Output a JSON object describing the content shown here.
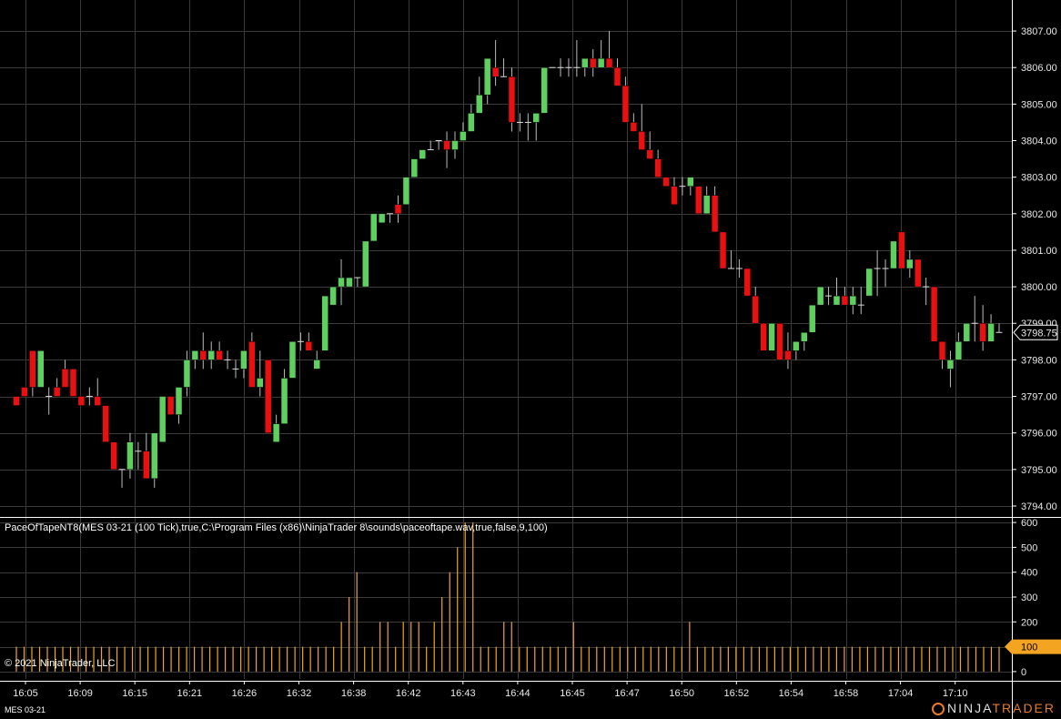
{
  "colors": {
    "up": "#5fcf5f",
    "down": "#e81010",
    "volume": "#f3a521",
    "grid": "#3a3a3a",
    "price_marker_bg": "#000000",
    "volume_marker_bg": "#f3a521"
  },
  "indicator_label": "PaceOfTapeNT8(MES 03-21 (100 Tick),true,C:\\Program Files (x86)\\NinjaTrader 8\\sounds\\paceoftape.wav,true,false,9,100)",
  "copyright": "© 2021 NinjaTrader, LLC",
  "instrument": "MES 03-21",
  "brand": {
    "ninja": "NINJA",
    "trader": "TRADER"
  },
  "price_marker": "3798.75",
  "volume_marker": "100",
  "chart_data": [
    {
      "type": "candlestick",
      "title": "MES 03-21 (100 Tick)",
      "ylim": [
        3793.75,
        3807.5
      ],
      "y_ticks": [
        "3794.00",
        "3795.00",
        "3796.00",
        "3797.00",
        "3798.00",
        "3799.00",
        "3800.00",
        "3801.00",
        "3802.00",
        "3803.00",
        "3804.00",
        "3805.00",
        "3806.00",
        "3807.00"
      ],
      "x_ticks": [
        "16:05",
        "16:09",
        "16:15",
        "16:21",
        "16:26",
        "16:32",
        "16:38",
        "16:42",
        "16:43",
        "16:44",
        "16:45",
        "16:47",
        "16:50",
        "16:52",
        "16:54",
        "16:58",
        "17:04",
        "17:10"
      ],
      "ohlc": [
        [
          3797.0,
          3797.0,
          3796.75,
          3796.75
        ],
        [
          3797.25,
          3797.25,
          3797.0,
          3797.0
        ],
        [
          3798.25,
          3798.25,
          3797.0,
          3797.25
        ],
        [
          3797.25,
          3798.25,
          3797.25,
          3798.25
        ],
        [
          3797.0,
          3797.25,
          3796.5,
          3797.0
        ],
        [
          3797.25,
          3797.5,
          3797.0,
          3797.0
        ],
        [
          3797.75,
          3798.0,
          3797.25,
          3797.25
        ],
        [
          3797.75,
          3797.75,
          3797.0,
          3797.0
        ],
        [
          3797.0,
          3797.0,
          3796.75,
          3796.75
        ],
        [
          3797.0,
          3797.25,
          3796.75,
          3797.0
        ],
        [
          3797.0,
          3797.5,
          3796.75,
          3796.75
        ],
        [
          3796.75,
          3796.75,
          3795.75,
          3795.75
        ],
        [
          3795.75,
          3795.75,
          3795.0,
          3795.0
        ],
        [
          3795.0,
          3795.0,
          3794.5,
          3795.0
        ],
        [
          3795.0,
          3796.0,
          3794.75,
          3795.75
        ],
        [
          3795.5,
          3795.75,
          3795.0,
          3795.5
        ],
        [
          3795.5,
          3796.0,
          3794.75,
          3794.75
        ],
        [
          3794.75,
          3796.0,
          3794.5,
          3796.0
        ],
        [
          3795.75,
          3797.0,
          3795.75,
          3797.0
        ],
        [
          3797.0,
          3797.0,
          3796.5,
          3796.5
        ],
        [
          3796.5,
          3797.25,
          3796.25,
          3797.25
        ],
        [
          3797.25,
          3798.25,
          3797.0,
          3798.0
        ],
        [
          3798.0,
          3798.25,
          3797.75,
          3798.25
        ],
        [
          3798.25,
          3798.75,
          3797.75,
          3798.0
        ],
        [
          3798.0,
          3798.5,
          3797.75,
          3798.25
        ],
        [
          3798.25,
          3798.5,
          3798.0,
          3798.0
        ],
        [
          3798.0,
          3798.25,
          3797.75,
          3798.0
        ],
        [
          3797.75,
          3798.0,
          3797.5,
          3797.75
        ],
        [
          3797.75,
          3798.25,
          3797.5,
          3798.25
        ],
        [
          3798.5,
          3798.75,
          3797.25,
          3797.25
        ],
        [
          3797.25,
          3798.25,
          3797.0,
          3797.5
        ],
        [
          3798.0,
          3798.0,
          3796.0,
          3796.0
        ],
        [
          3795.75,
          3796.5,
          3795.75,
          3796.25
        ],
        [
          3796.25,
          3797.75,
          3796.25,
          3797.5
        ],
        [
          3797.5,
          3798.5,
          3797.5,
          3798.5
        ],
        [
          3798.5,
          3798.75,
          3798.25,
          3798.5
        ],
        [
          3798.5,
          3798.75,
          3798.25,
          3798.25
        ],
        [
          3797.75,
          3798.25,
          3797.75,
          3798.0
        ],
        [
          3798.25,
          3799.75,
          3798.25,
          3799.75
        ],
        [
          3799.5,
          3800.0,
          3799.5,
          3800.0
        ],
        [
          3800.0,
          3800.75,
          3799.5,
          3800.25
        ],
        [
          3800.0,
          3800.25,
          3800.0,
          3800.25
        ],
        [
          3800.25,
          3800.25,
          3800.0,
          3800.25
        ],
        [
          3800.0,
          3801.25,
          3800.0,
          3801.25
        ],
        [
          3801.25,
          3802.0,
          3801.25,
          3802.0
        ],
        [
          3801.75,
          3802.0,
          3801.75,
          3802.0
        ],
        [
          3802.0,
          3802.0,
          3801.75,
          3802.0
        ],
        [
          3802.25,
          3802.5,
          3801.75,
          3802.0
        ],
        [
          3802.25,
          3803.0,
          3802.25,
          3803.0
        ],
        [
          3803.0,
          3803.5,
          3803.0,
          3803.5
        ],
        [
          3803.5,
          3803.75,
          3803.5,
          3803.75
        ],
        [
          3803.75,
          3804.0,
          3803.75,
          3803.75
        ],
        [
          3804.0,
          3804.0,
          3803.75,
          3804.0
        ],
        [
          3804.0,
          3804.25,
          3803.25,
          3803.75
        ],
        [
          3803.75,
          3804.25,
          3803.5,
          3804.0
        ],
        [
          3804.0,
          3804.5,
          3804.0,
          3804.25
        ],
        [
          3804.25,
          3805.0,
          3804.25,
          3804.75
        ],
        [
          3804.75,
          3805.75,
          3804.75,
          3805.25
        ],
        [
          3805.25,
          3806.25,
          3805.0,
          3806.25
        ],
        [
          3806.0,
          3806.75,
          3805.5,
          3805.75
        ],
        [
          3805.75,
          3806.25,
          3805.75,
          3805.75
        ],
        [
          3805.75,
          3806.0,
          3804.25,
          3804.5
        ],
        [
          3804.5,
          3804.75,
          3804.25,
          3804.5
        ],
        [
          3804.5,
          3804.75,
          3804.0,
          3804.5
        ],
        [
          3804.5,
          3804.75,
          3804.0,
          3804.75
        ],
        [
          3804.75,
          3806.0,
          3804.75,
          3806.0
        ],
        [
          3806.0,
          3806.0,
          3806.0,
          3806.0
        ],
        [
          3806.0,
          3806.25,
          3805.75,
          3806.0
        ],
        [
          3806.0,
          3806.25,
          3805.75,
          3806.0
        ],
        [
          3806.0,
          3806.75,
          3805.75,
          3806.0
        ],
        [
          3806.0,
          3806.25,
          3805.75,
          3806.25
        ],
        [
          3806.25,
          3806.5,
          3805.75,
          3806.0
        ],
        [
          3806.0,
          3806.75,
          3806.0,
          3806.25
        ],
        [
          3806.25,
          3807.0,
          3806.0,
          3806.0
        ],
        [
          3806.0,
          3806.25,
          3805.5,
          3805.5
        ],
        [
          3805.5,
          3805.75,
          3804.5,
          3804.5
        ],
        [
          3804.5,
          3804.75,
          3804.25,
          3804.25
        ],
        [
          3804.25,
          3805.0,
          3803.75,
          3803.75
        ],
        [
          3803.75,
          3804.25,
          3803.5,
          3803.5
        ],
        [
          3803.5,
          3803.75,
          3803.0,
          3803.0
        ],
        [
          3803.0,
          3803.0,
          3802.75,
          3802.75
        ],
        [
          3802.75,
          3803.0,
          3802.25,
          3802.25
        ],
        [
          3802.75,
          3803.0,
          3802.5,
          3802.75
        ],
        [
          3802.75,
          3803.0,
          3802.5,
          3803.0
        ],
        [
          3802.75,
          3802.75,
          3802.0,
          3802.0
        ],
        [
          3802.0,
          3802.75,
          3802.0,
          3802.5
        ],
        [
          3802.5,
          3802.75,
          3801.5,
          3801.5
        ],
        [
          3801.5,
          3801.5,
          3800.5,
          3800.5
        ],
        [
          3800.5,
          3801.0,
          3800.5,
          3800.5
        ],
        [
          3800.5,
          3800.75,
          3800.25,
          3800.5
        ],
        [
          3800.5,
          3800.5,
          3799.75,
          3799.75
        ],
        [
          3799.75,
          3800.0,
          3799.0,
          3799.0
        ],
        [
          3799.0,
          3799.0,
          3798.25,
          3798.25
        ],
        [
          3798.25,
          3799.0,
          3798.25,
          3799.0
        ],
        [
          3799.0,
          3799.0,
          3798.0,
          3798.0
        ],
        [
          3798.25,
          3798.75,
          3797.75,
          3798.0
        ],
        [
          3798.25,
          3798.5,
          3798.0,
          3798.5
        ],
        [
          3798.5,
          3798.75,
          3798.25,
          3798.75
        ],
        [
          3798.75,
          3799.5,
          3798.75,
          3799.5
        ],
        [
          3799.5,
          3800.0,
          3799.5,
          3800.0
        ],
        [
          3799.75,
          3800.0,
          3799.5,
          3799.75
        ],
        [
          3799.5,
          3800.25,
          3799.5,
          3799.75
        ],
        [
          3799.75,
          3800.0,
          3799.5,
          3799.5
        ],
        [
          3799.5,
          3800.0,
          3799.25,
          3799.75
        ],
        [
          3799.5,
          3800.0,
          3799.25,
          3799.5
        ],
        [
          3799.75,
          3800.5,
          3799.75,
          3800.5
        ],
        [
          3800.5,
          3801.0,
          3799.75,
          3800.5
        ],
        [
          3800.5,
          3800.75,
          3800.0,
          3800.5
        ],
        [
          3800.5,
          3801.25,
          3800.5,
          3801.25
        ],
        [
          3801.5,
          3801.5,
          3800.5,
          3800.5
        ],
        [
          3800.5,
          3801.0,
          3800.25,
          3800.75
        ],
        [
          3800.75,
          3800.75,
          3800.0,
          3800.0
        ],
        [
          3800.0,
          3800.25,
          3799.5,
          3800.0
        ],
        [
          3800.0,
          3800.0,
          3798.5,
          3798.5
        ],
        [
          3798.5,
          3798.5,
          3797.75,
          3798.0
        ],
        [
          3797.75,
          3798.25,
          3797.25,
          3798.0
        ],
        [
          3798.0,
          3798.75,
          3798.0,
          3798.5
        ],
        [
          3798.5,
          3799.0,
          3798.5,
          3799.0
        ],
        [
          3799.0,
          3799.75,
          3798.5,
          3799.0
        ],
        [
          3799.0,
          3799.5,
          3798.25,
          3798.5
        ],
        [
          3798.5,
          3799.25,
          3798.5,
          3799.0
        ],
        [
          3798.75,
          3799.0,
          3798.75,
          3798.75
        ]
      ]
    },
    {
      "type": "bar",
      "title": "PaceOfTapeNT8",
      "ylim": [
        -15,
        615
      ],
      "y_ticks": [
        "0",
        "100",
        "200",
        "300",
        "400",
        "500",
        "600"
      ],
      "values": [
        100,
        100,
        100,
        100,
        100,
        100,
        100,
        100,
        100,
        100,
        100,
        100,
        100,
        100,
        100,
        100,
        100,
        100,
        100,
        100,
        100,
        100,
        100,
        100,
        100,
        100,
        100,
        100,
        100,
        100,
        100,
        100,
        100,
        100,
        100,
        100,
        100,
        100,
        100,
        100,
        100,
        100,
        200,
        300,
        400,
        100,
        100,
        200,
        200,
        100,
        200,
        200,
        200,
        100,
        200,
        300,
        400,
        500,
        600,
        600,
        100,
        100,
        100,
        200,
        200,
        100,
        100,
        100,
        100,
        100,
        100,
        100,
        200,
        100,
        100,
        100,
        100,
        100,
        100,
        100,
        100,
        100,
        100,
        100,
        100,
        100,
        100,
        200,
        100,
        100,
        100,
        100,
        100,
        100,
        100,
        100,
        100,
        100,
        100,
        100,
        100,
        100,
        100,
        100,
        100,
        100,
        100,
        100,
        100,
        100,
        100,
        100,
        100,
        100,
        100,
        100,
        100,
        100,
        100,
        100,
        100,
        100,
        100,
        100,
        100,
        100,
        100,
        100
      ]
    }
  ]
}
